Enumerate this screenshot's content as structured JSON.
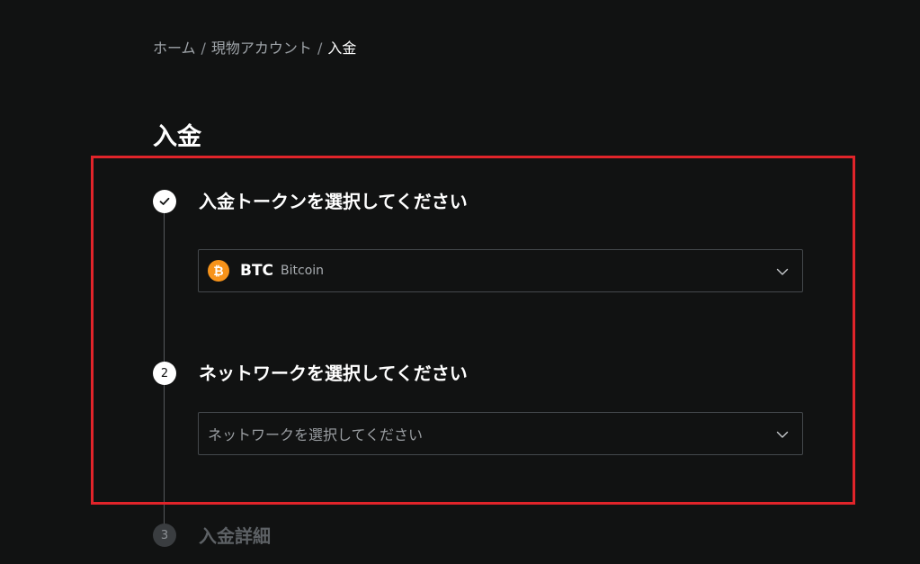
{
  "breadcrumb": {
    "items": [
      "ホーム",
      "現物アカウント",
      "入金"
    ],
    "separator": "/"
  },
  "page": {
    "title": "入金"
  },
  "steps": [
    {
      "number": "1",
      "status": "done",
      "icon": "check-icon",
      "title": "入金トークンを選択してください",
      "select": {
        "coin_symbol": "BTC",
        "coin_name": "Bitcoin",
        "coin_icon": "bitcoin-icon",
        "coin_icon_glyph": "₿"
      }
    },
    {
      "number": "2",
      "status": "active",
      "title": "ネットワークを選択してください",
      "select": {
        "placeholder": "ネットワークを選択してください"
      }
    },
    {
      "number": "3",
      "status": "pending",
      "title": "入金詳細"
    }
  ],
  "colors": {
    "background": "#111212",
    "highlight": "#e1242a",
    "bitcoin": "#f7931a",
    "muted_text": "#5d6165"
  }
}
